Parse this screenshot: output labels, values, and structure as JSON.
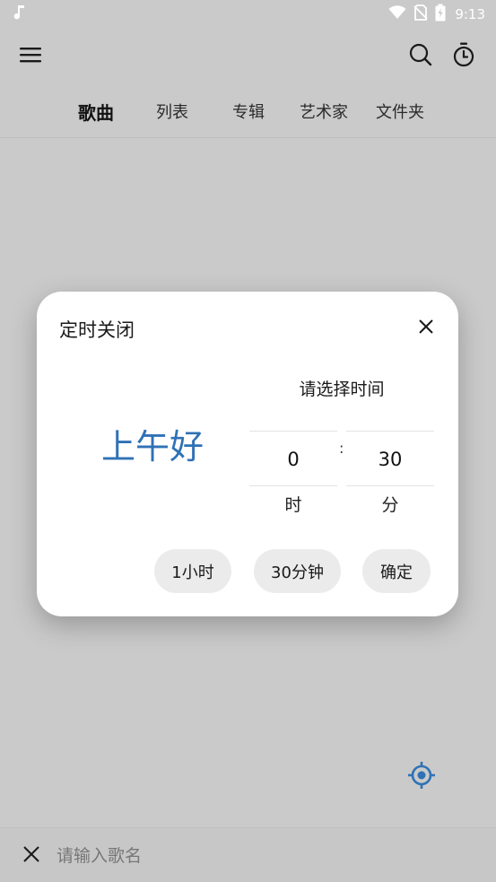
{
  "status_bar": {
    "time": "9:13",
    "icons": [
      "music-note-icon",
      "wifi-icon",
      "no-sim-icon",
      "battery-charging-icon"
    ]
  },
  "app_bar": {
    "icons": [
      "menu-icon",
      "search-icon",
      "timer-icon"
    ]
  },
  "tabs": [
    {
      "label": "歌曲",
      "active": true
    },
    {
      "label": "列表",
      "active": false
    },
    {
      "label": "专辑",
      "active": false
    },
    {
      "label": "艺术家",
      "active": false
    },
    {
      "label": "文件夹",
      "active": false
    }
  ],
  "dialog": {
    "title": "定时关闭",
    "greeting": "上午好",
    "picker_title": "请选择时间",
    "hours_value": "0",
    "minutes_value": "30",
    "separator": ":",
    "hours_unit": "时",
    "minutes_unit": "分",
    "buttons": {
      "one_hour": "1小时",
      "thirty_min": "30分钟",
      "confirm": "确定"
    }
  },
  "search_bar": {
    "placeholder": "请输入歌名",
    "value": ""
  },
  "colors": {
    "accent": "#2f72b5",
    "background": "#cacaca",
    "dialog_bg": "#ffffff",
    "pill_bg": "#ebebeb"
  }
}
